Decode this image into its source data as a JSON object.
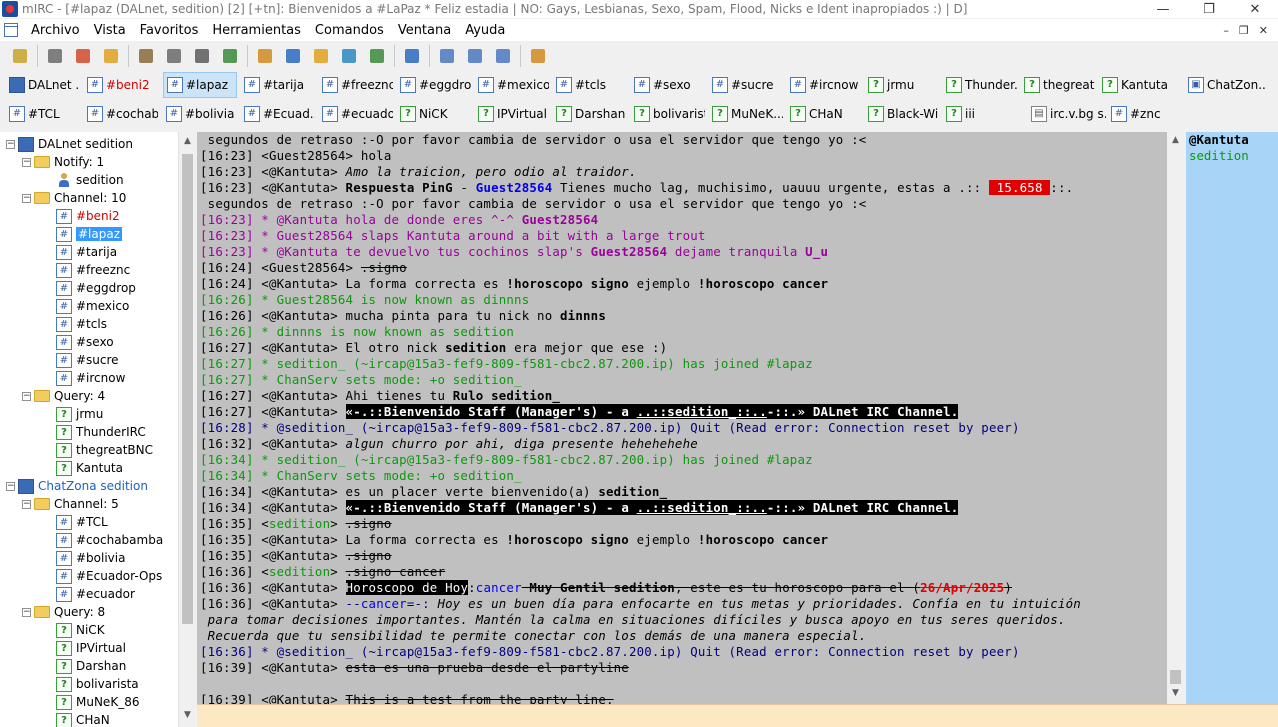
{
  "window": {
    "title": "mIRC - [#lapaz (DALnet, sedition) [2] [+tn]:  Bienvenidos a #LaPaz * Feliz estadia | NO: Gays, Lesbianas, Sexo, Spam, Flood, Nicks e Ident inapropiados :) | D]",
    "minimize": "—",
    "restore": "❐",
    "close": "✕"
  },
  "menu": {
    "items": [
      "Archivo",
      "Vista",
      "Favoritos",
      "Herramientas",
      "Comandos",
      "Ventana",
      "Ayuda"
    ],
    "mdi_controls": [
      "–",
      "❐",
      "✕"
    ]
  },
  "toolbar": {
    "icons": [
      "connect-icon",
      "options-icon",
      "address-book-icon",
      "favorites-icon",
      "scripts-editor-icon",
      "channel-list-icon",
      "timer-icon",
      "colors-icon",
      "dcc-send-icon",
      "dcc-chat-icon",
      "notify-icon",
      "urls-icon",
      "log-icon",
      "channels-folder-icon",
      "tile-horizontal-icon",
      "tile-vertical-icon",
      "cascade-icon",
      "help-icon"
    ]
  },
  "switchbar": {
    "row1": [
      {
        "label": "DALnet ...",
        "type": "server"
      },
      {
        "label": "#beni2",
        "type": "channel",
        "color": "#d00000"
      },
      {
        "label": "#lapaz",
        "type": "channel",
        "active": true
      },
      {
        "label": "#tarija",
        "type": "channel"
      },
      {
        "label": "#freeznc",
        "type": "channel"
      },
      {
        "label": "#eggdrop",
        "type": "channel"
      },
      {
        "label": "#mexico",
        "type": "channel"
      },
      {
        "label": "#tcls",
        "type": "channel"
      },
      {
        "label": "#sexo",
        "type": "channel"
      },
      {
        "label": "#sucre",
        "type": "channel"
      },
      {
        "label": "#ircnow",
        "type": "channel"
      },
      {
        "label": "jrmu",
        "type": "query"
      },
      {
        "label": "Thunder...",
        "type": "query"
      },
      {
        "label": "thegreat...",
        "type": "query"
      },
      {
        "label": "Kantuta",
        "type": "query"
      },
      {
        "label": "ChatZon...",
        "type": "chatzona"
      }
    ],
    "row2": [
      {
        "label": "#TCL",
        "type": "channel"
      },
      {
        "label": "#cochab...",
        "type": "channel"
      },
      {
        "label": "#bolivia",
        "type": "channel"
      },
      {
        "label": "#Ecuad...",
        "type": "channel"
      },
      {
        "label": "#ecuador",
        "type": "channel"
      },
      {
        "label": "NiCK",
        "type": "query"
      },
      {
        "label": "IPVirtual",
        "type": "query"
      },
      {
        "label": "Darshan",
        "type": "query"
      },
      {
        "label": "bolivarista",
        "type": "query"
      },
      {
        "label": "MuNeK...",
        "type": "query"
      },
      {
        "label": "CHaN",
        "type": "query"
      },
      {
        "label": "Black-Wi...",
        "type": "query"
      },
      {
        "label": "iii",
        "type": "query"
      },
      {
        "label": "irc.v.bg s...",
        "type": "status"
      },
      {
        "label": "#znc",
        "type": "channel"
      }
    ]
  },
  "tree": {
    "nodes": [
      {
        "label": "DALnet sedition",
        "kind": "server",
        "level": 0,
        "exp": "−"
      },
      {
        "label": "Notify: 1",
        "kind": "folder",
        "level": 1,
        "exp": "−"
      },
      {
        "label": "sedition",
        "kind": "person",
        "level": 2
      },
      {
        "label": "Channel: 10",
        "kind": "folder",
        "level": 1,
        "exp": "−"
      },
      {
        "label": "#beni2",
        "kind": "chan",
        "level": 2,
        "color": "#d00000"
      },
      {
        "label": "#lapaz",
        "kind": "chan",
        "level": 2,
        "selected": true
      },
      {
        "label": "#tarija",
        "kind": "chan",
        "level": 2
      },
      {
        "label": "#freeznc",
        "kind": "chan",
        "level": 2
      },
      {
        "label": "#eggdrop",
        "kind": "chan",
        "level": 2
      },
      {
        "label": "#mexico",
        "kind": "chan",
        "level": 2
      },
      {
        "label": "#tcls",
        "kind": "chan",
        "level": 2
      },
      {
        "label": "#sexo",
        "kind": "chan",
        "level": 2
      },
      {
        "label": "#sucre",
        "kind": "chan",
        "level": 2
      },
      {
        "label": "#ircnow",
        "kind": "chan",
        "level": 2
      },
      {
        "label": "Query: 4",
        "kind": "folder",
        "level": 1,
        "exp": "−"
      },
      {
        "label": "jrmu",
        "kind": "query",
        "level": 2
      },
      {
        "label": "ThunderIRC",
        "kind": "query",
        "level": 2
      },
      {
        "label": "thegreatBNC",
        "kind": "query",
        "level": 2
      },
      {
        "label": "Kantuta",
        "kind": "query",
        "level": 2
      },
      {
        "label": "ChatZona sedition",
        "kind": "server",
        "level": 0,
        "exp": "−",
        "color": "#1f5fbf"
      },
      {
        "label": "Channel: 5",
        "kind": "folder",
        "level": 1,
        "exp": "−"
      },
      {
        "label": "#TCL",
        "kind": "chan",
        "level": 2
      },
      {
        "label": "#cochabamba",
        "kind": "chan",
        "level": 2
      },
      {
        "label": "#bolivia",
        "kind": "chan",
        "level": 2
      },
      {
        "label": "#Ecuador-Ops",
        "kind": "chan",
        "level": 2
      },
      {
        "label": "#ecuador",
        "kind": "chan",
        "level": 2
      },
      {
        "label": "Query: 8",
        "kind": "folder",
        "level": 1,
        "exp": "−"
      },
      {
        "label": "NiCK",
        "kind": "query",
        "level": 2
      },
      {
        "label": "IPVirtual",
        "kind": "query",
        "level": 2
      },
      {
        "label": "Darshan",
        "kind": "query",
        "level": 2
      },
      {
        "label": "bolivarista",
        "kind": "query",
        "level": 2
      },
      {
        "label": "MuNeK_86",
        "kind": "query",
        "level": 2
      },
      {
        "label": "CHaN",
        "kind": "query",
        "level": 2
      }
    ]
  },
  "nicklist": [
    {
      "nick": "@Kantuta",
      "color": "#000000"
    },
    {
      "nick": "sedition",
      "color": "#0a9a0a"
    }
  ],
  "chat": {
    "lines": [
      [
        {
          "t": " segundos de retraso :-O por favor cambia de servidor o usa el servidor que tengo yo :<"
        }
      ],
      [
        {
          "t": "[16:23] <Guest28564> hola"
        }
      ],
      [
        {
          "t": "[16:23] <@Kantuta> "
        },
        {
          "t": "Amo la traicion, pero odio al traidor.",
          "c": "i"
        }
      ],
      [
        {
          "t": "[16:23] <@Kantuta> "
        },
        {
          "t": "Respuesta PinG",
          "c": "b"
        },
        {
          "t": " - "
        },
        {
          "t": "Guest28564",
          "c": "b blue"
        },
        {
          "t": " Tienes mucho lag, muchisimo, uauuu urgente, estas a .:: "
        },
        {
          "t": " 15.658 ",
          "c": "lagbox"
        },
        {
          "t": "::."
        }
      ],
      [
        {
          "t": " segundos de retraso :-O por favor cambia de servidor o usa el servidor que tengo yo :<"
        }
      ],
      [
        {
          "t": "[16:23] * @Kantuta hola de donde eres ^-^ ",
          "c": "purple"
        },
        {
          "t": "Guest28564",
          "c": "purple b"
        }
      ],
      [
        {
          "t": "[16:23] * Guest28564 slaps Kantuta around a bit with a large trout",
          "c": "purple"
        }
      ],
      [
        {
          "t": "[16:23] * @Kantuta te devuelvo tus cochinos slap's ",
          "c": "purple"
        },
        {
          "t": "Guest28564",
          "c": "purple b"
        },
        {
          "t": " dejame tranquila ",
          "c": "purple"
        },
        {
          "t": "U_u",
          "c": "purple b"
        }
      ],
      [
        {
          "t": "[16:24] <Guest28564> "
        },
        {
          "t": ".signo",
          "c": "s"
        }
      ],
      [
        {
          "t": "[16:24] <@Kantuta> La forma correcta es "
        },
        {
          "t": "!horoscopo signo",
          "c": "b"
        },
        {
          "t": " ejemplo "
        },
        {
          "t": "!horoscopo cancer",
          "c": "b"
        }
      ],
      [
        {
          "t": "[16:26] * Guest28564 is now known as dinnns",
          "c": "green"
        }
      ],
      [
        {
          "t": "[16:26] <@Kantuta> mucha pinta para tu nick no "
        },
        {
          "t": "dinnns",
          "c": "b"
        }
      ],
      [
        {
          "t": "[16:26] * dinnns is now known as sedition",
          "c": "green"
        }
      ],
      [
        {
          "t": "[16:27] <@Kantuta> El otro nick "
        },
        {
          "t": "sedition",
          "c": "b"
        },
        {
          "t": " era mejor que ese :)"
        }
      ],
      [
        {
          "t": "[16:27] * sedition_ (~ircap@15a3-fef9-809-f581-cbc2.87.200.ip) has joined #lapaz",
          "c": "green"
        }
      ],
      [
        {
          "t": "[16:27] * ChanServ sets mode: +o sedition_",
          "c": "green"
        }
      ],
      [
        {
          "t": "[16:27] <@Kantuta> Ahi tienes tu "
        },
        {
          "t": "Rulo sedition_",
          "c": "b"
        }
      ],
      [
        {
          "t": "[16:27] <@Kantuta> "
        },
        {
          "t": "«-.::",
          "c": "inv b"
        },
        {
          "t": "Bienvenido",
          "c": "inv b y"
        },
        {
          "t": " Staff (Manager's) ",
          "c": "inv b"
        },
        {
          "t": "- a ",
          "c": "inv b r"
        },
        {
          "t": "..::sedition_::..",
          "c": "inv b u"
        },
        {
          "t": "-::.» ",
          "c": "inv b"
        },
        {
          "t": "DALnet",
          "c": "inv b r"
        },
        {
          "t": " IRC ",
          "c": "inv b y"
        },
        {
          "t": "Channel.",
          "c": "inv b r"
        }
      ],
      [
        {
          "t": "[16:28] * @sedition_ (~ircap@15a3-fef9-809-f581-cbc2.87.200.ip) Quit (Read error: Connection reset by peer)",
          "c": "navy"
        }
      ],
      [
        {
          "t": "[16:32] <@Kantuta> "
        },
        {
          "t": "algun churro por ahi, diga presente hehehehehe",
          "c": "i"
        }
      ],
      [
        {
          "t": "[16:34] * sedition_ (~ircap@15a3-fef9-809-f581-cbc2.87.200.ip) has joined #lapaz",
          "c": "green"
        }
      ],
      [
        {
          "t": "[16:34] * ChanServ sets mode: +o sedition_",
          "c": "green"
        }
      ],
      [
        {
          "t": "[16:34] <@Kantuta> es un placer verte bienvenido(a) "
        },
        {
          "t": "sedition_",
          "c": "b"
        }
      ],
      [
        {
          "t": "[16:34] <@Kantuta> "
        },
        {
          "t": "«-.::",
          "c": "inv b"
        },
        {
          "t": "Bienvenido",
          "c": "inv b y"
        },
        {
          "t": " Staff (Manager's) ",
          "c": "inv b"
        },
        {
          "t": "- a ",
          "c": "inv b r"
        },
        {
          "t": "..::sedition_::..",
          "c": "inv b u"
        },
        {
          "t": "-::.» ",
          "c": "inv b"
        },
        {
          "t": "DALnet",
          "c": "inv b r"
        },
        {
          "t": " IRC ",
          "c": "inv b y"
        },
        {
          "t": "Channel.",
          "c": "inv b r"
        }
      ],
      [
        {
          "t": "[16:35] <"
        },
        {
          "t": "sedition",
          "c": "green"
        },
        {
          "t": "> "
        },
        {
          "t": ".signo",
          "c": "s"
        }
      ],
      [
        {
          "t": "[16:35] <@Kantuta> La forma correcta es "
        },
        {
          "t": "!horoscopo signo",
          "c": "b"
        },
        {
          "t": " ejemplo "
        },
        {
          "t": "!horoscopo cancer",
          "c": "b"
        }
      ],
      [
        {
          "t": "[16:35] <@Kantuta> "
        },
        {
          "t": ".signo",
          "c": "s"
        }
      ],
      [
        {
          "t": "[16:36] <"
        },
        {
          "t": "sedition",
          "c": "green"
        },
        {
          "t": "> "
        },
        {
          "t": ".signo cancer",
          "c": "s"
        }
      ],
      [
        {
          "t": "[16:36] <@Kantuta> "
        },
        {
          "t": "Horoscopo de Hoy",
          "c": "inv"
        },
        {
          "t": ":"
        },
        {
          "t": "cancer",
          "c": "blue"
        },
        {
          "t": " Muy Gentil sedition",
          "c": "b s"
        },
        {
          "t": ", este es tu horoscopo para el (",
          "c": "s"
        },
        {
          "t": "26/Apr/2025",
          "c": "red b s"
        },
        {
          "t": ")",
          "c": "s"
        }
      ],
      [
        {
          "t": "[16:36] <@Kantuta> "
        },
        {
          "t": "--",
          "c": "navy"
        },
        {
          "t": "cancer",
          "c": "blue"
        },
        {
          "t": "=-:",
          "c": "navy"
        },
        {
          "t": " Hoy es un buen día para enfocarte en tus metas y prioridades. Confía en tu intuición",
          "c": "i"
        }
      ],
      [
        {
          "t": " para tomar decisiones importantes. Mantén la calma en situaciones difíciles y busca apoyo en tus seres queridos.",
          "c": "i"
        }
      ],
      [
        {
          "t": " Recuerda que tu sensibilidad te permite conectar con los demás de una manera especial.",
          "c": "i"
        }
      ],
      [
        {
          "t": "[16:36] * @sedition_ (~ircap@15a3-fef9-809-f581-cbc2.87.200.ip) Quit (Read error: Connection reset by peer)",
          "c": "navy"
        }
      ],
      [
        {
          "t": "[16:39] <@Kantuta> "
        },
        {
          "t": "esta es una prueba desde el partyline",
          "c": "s"
        }
      ],
      [
        {
          "t": ""
        }
      ],
      [
        {
          "t": "[16:39] <@Kantuta> "
        },
        {
          "t": "This is a test from the party line.",
          "c": "s"
        }
      ]
    ]
  },
  "editbox": {
    "value": ""
  }
}
